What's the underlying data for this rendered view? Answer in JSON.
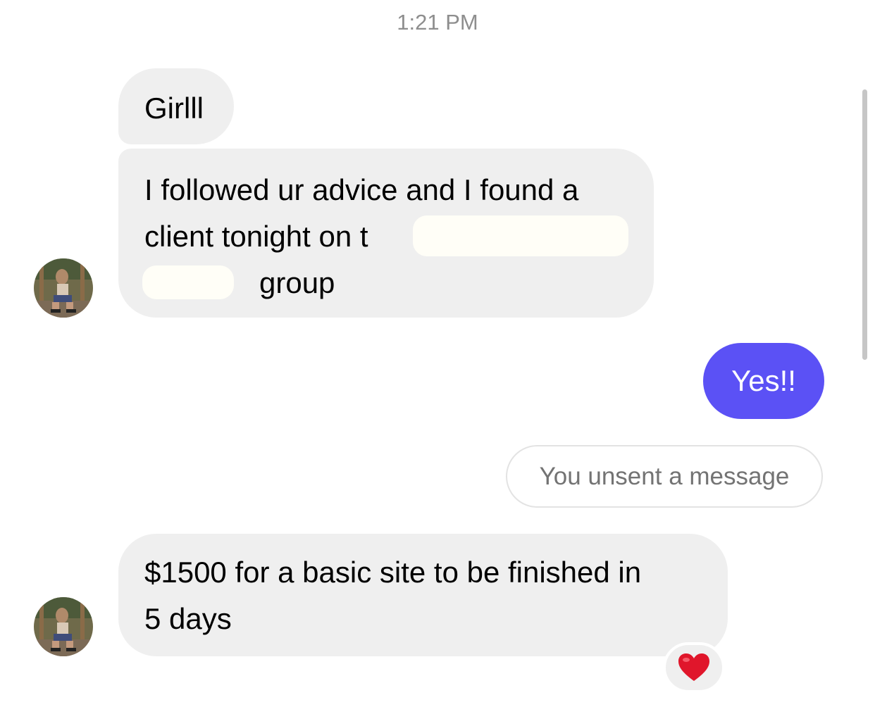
{
  "thread": {
    "timestamp": "1:21 PM",
    "messages": [
      {
        "sender": "them",
        "text": "Girlll"
      },
      {
        "sender": "them",
        "lines": [
          "I followed ur advice and I found a",
          "client tonight on t",
          "group"
        ]
      },
      {
        "sender": "me",
        "text": "Yes!!"
      },
      {
        "sender": "me",
        "status": "You unsent a message"
      },
      {
        "sender": "them",
        "lines": [
          "$1500 for a basic site to be finished in",
          "5 days"
        ],
        "reaction": "heart-icon"
      }
    ]
  },
  "colors": {
    "incoming_bubble": "#efefef",
    "outgoing_bubble": "#5b51f5",
    "reaction_heart": "#e0162b",
    "timestamp_text": "#8e8e8e"
  }
}
